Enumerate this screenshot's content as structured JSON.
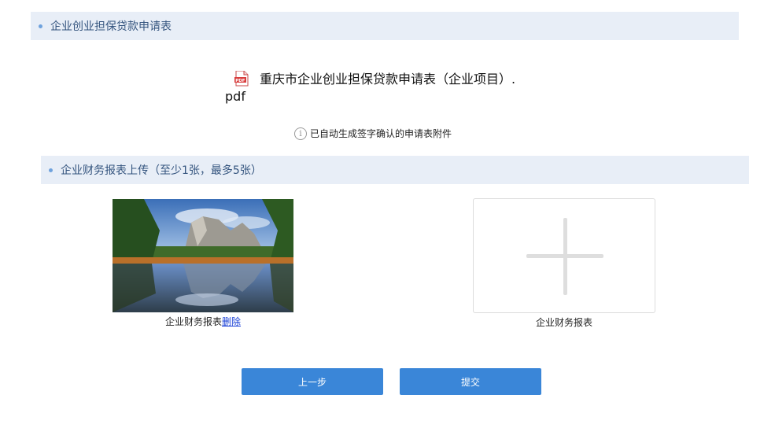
{
  "section1": {
    "title": "企业创业担保贷款申请表"
  },
  "file": {
    "icon": "pdf-file-icon",
    "name": "重庆市企业创业担保贷款申请表（企业项目）.pdf"
  },
  "hint": {
    "icon": "info-icon",
    "icon_glyph": "i",
    "text": "已自动生成签字确认的申请表附件"
  },
  "section2": {
    "title": "企业财务报表上传（至少1张，最多5张）"
  },
  "uploads": {
    "left": {
      "caption": "企业财务报表",
      "delete_label": "删除"
    },
    "right": {
      "caption": "企业财务报表"
    }
  },
  "buttons": {
    "prev": "上一步",
    "submit": "提交"
  },
  "colors": {
    "accent": "#3a86d8",
    "section_bg": "#e8eef7",
    "section_text": "#35557f",
    "link": "#1a40d6"
  }
}
